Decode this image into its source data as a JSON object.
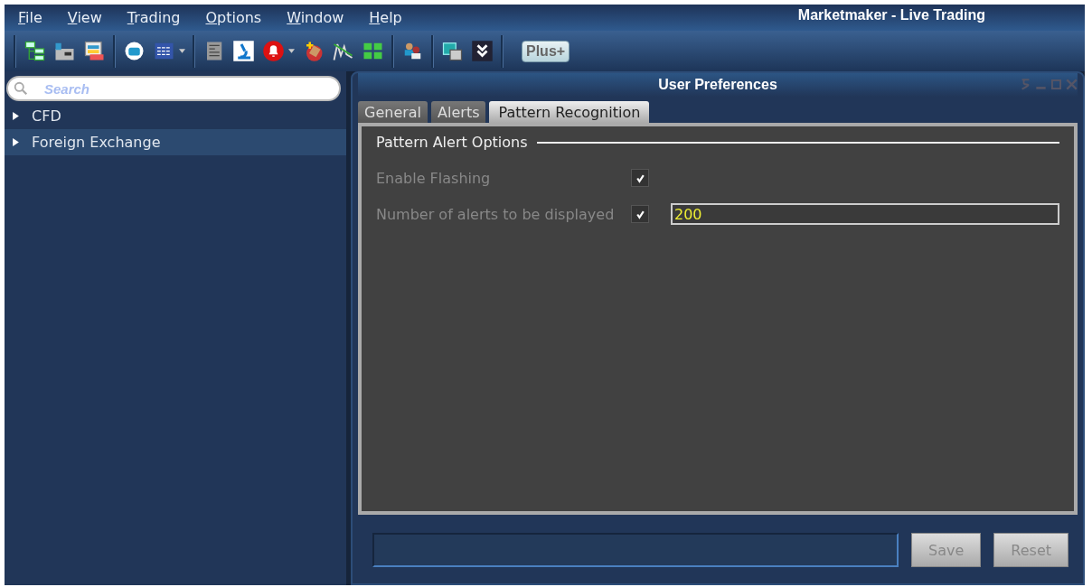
{
  "menu": [
    {
      "label": "File"
    },
    {
      "label": "View"
    },
    {
      "label": "Trading"
    },
    {
      "label": "Options"
    },
    {
      "label": "Window"
    },
    {
      "label": "Help"
    }
  ],
  "window": {
    "title": "Marketmaker - Live Trading"
  },
  "toolbar": {
    "plus_button": "Plus+"
  },
  "sidebar": {
    "search": {
      "placeholder": "Search"
    },
    "items": [
      {
        "label": "CFD",
        "selected": false,
        "expanded": false
      },
      {
        "label": "Foreign Exchange",
        "selected": true,
        "expanded": false
      }
    ]
  },
  "dialog": {
    "title": "User Preferences",
    "tabs": [
      {
        "label": "General",
        "selected": false
      },
      {
        "label": "Alerts",
        "selected": false
      },
      {
        "label": "Pattern Recognition",
        "selected": true
      }
    ],
    "group": "Pattern Alert Options",
    "options": [
      {
        "label": "Enable Flashing",
        "checked": true
      },
      {
        "label": "Number of alerts to be displayed",
        "checked": true,
        "value": "200"
      }
    ],
    "buttons": [
      {
        "label": "Save",
        "disabled": true
      },
      {
        "label": "Reset",
        "disabled": true
      }
    ]
  }
}
